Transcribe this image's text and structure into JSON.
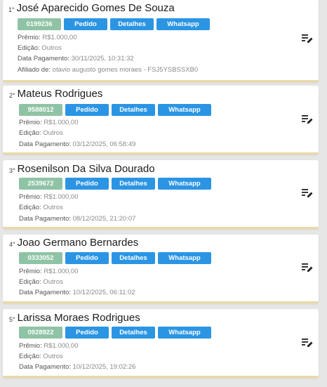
{
  "labels": {
    "premio": "Prêmio:",
    "edicao": "Edição:",
    "data_pagamento": "Data Pagamento:",
    "afiliado": "Afiliado de:"
  },
  "buttons": {
    "pedido": "Pedido",
    "detalhes": "Detalhes",
    "whatsapp": "Whatsapp"
  },
  "icons": {
    "edit": "playlist-edit-icon"
  },
  "colors": {
    "code_badge": "#8fc3a5",
    "action_button": "#2b95e4",
    "card_accent": "#ead9a4"
  },
  "entries": [
    {
      "rank": "1°",
      "name": "José Aparecido Gomes De Souza",
      "code": "0199236",
      "premio": "R$1.000,00",
      "edicao": "Outros",
      "data_pagamento": "30/11/2025, 10:31:32",
      "afiliado": "otavio augusto gomes moraes - FSJ5YSBSSXB0"
    },
    {
      "rank": "2°",
      "name": "Mateus Rodrigues",
      "code": "9588012",
      "premio": "R$1.000,00",
      "edicao": "Outros",
      "data_pagamento": "03/12/2025, 06:58:49"
    },
    {
      "rank": "3°",
      "name": "Rosenilson Da Silva Dourado",
      "code": "2539672",
      "premio": "R$1.000,00",
      "edicao": "Outros",
      "data_pagamento": "08/12/2025, 21:20:07"
    },
    {
      "rank": "4°",
      "name": "Joao Germano Bernardes",
      "code": "0333052",
      "premio": "R$1.000,00",
      "edicao": "Outros",
      "data_pagamento": "10/12/2025, 06:11:02"
    },
    {
      "rank": "5°",
      "name": "Larissa Moraes Rodrigues",
      "code": "0928922",
      "premio": "R$1.000,00",
      "edicao": "Outros",
      "data_pagamento": "10/12/2025, 19:02:26"
    }
  ]
}
